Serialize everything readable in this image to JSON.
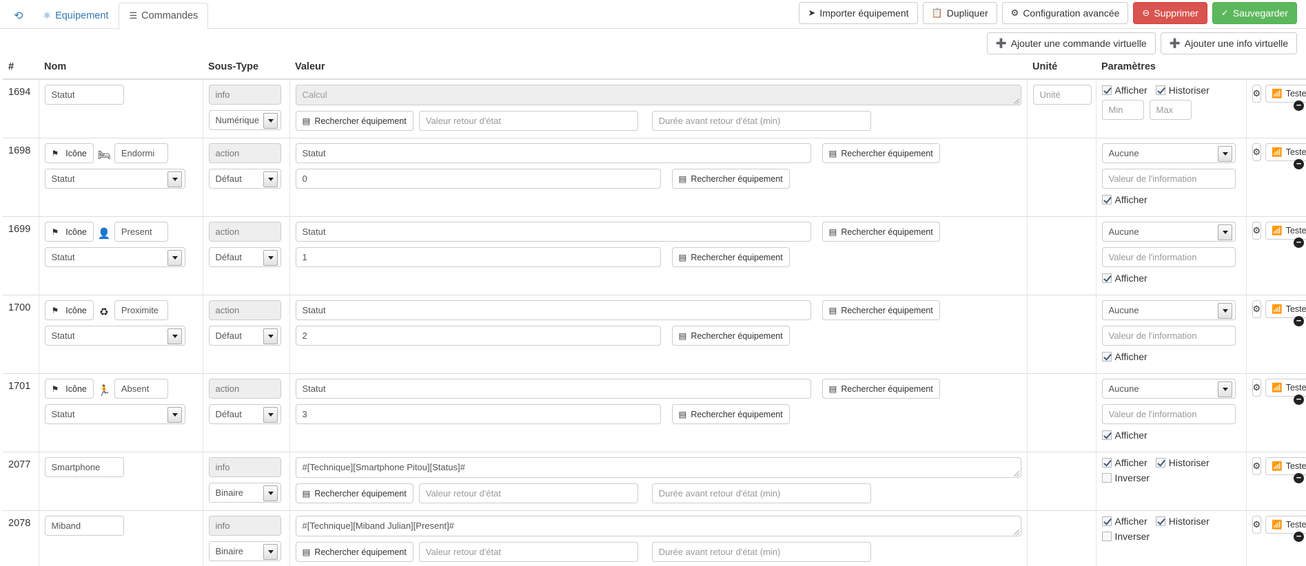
{
  "header": {
    "back_icon": "back-arrow-icon",
    "tabs": [
      {
        "label": "Equipement",
        "icon": "dashboard-icon",
        "active": false
      },
      {
        "label": "Commandes",
        "icon": "list-icon",
        "active": true
      }
    ],
    "toolbar": [
      {
        "label": "Importer équipement",
        "icon": "share-icon",
        "style": "default"
      },
      {
        "label": "Dupliquer",
        "icon": "copy-icon",
        "style": "default"
      },
      {
        "label": "Configuration avancée",
        "icon": "gears-icon",
        "style": "default"
      },
      {
        "label": "Supprimer",
        "icon": "minus-circle-icon",
        "style": "danger"
      },
      {
        "label": "Sauvegarder",
        "icon": "check-circle-icon",
        "style": "success"
      }
    ],
    "subtoolbar": [
      {
        "label": "Ajouter une commande virtuelle",
        "icon": "plus-circle-icon"
      },
      {
        "label": "Ajouter une info virtuelle",
        "icon": "plus-circle-icon"
      }
    ]
  },
  "colors": {
    "danger": "#d9534f",
    "success": "#5cb85c",
    "link": "#337ab7",
    "border": "#dddddd"
  },
  "table": {
    "columns": [
      "#",
      "Nom",
      "Sous-Type",
      "Valeur",
      "Unité",
      "Paramètres",
      ""
    ],
    "labels": {
      "rechercher": "Rechercher équipement",
      "tester": "Tester",
      "afficher": "Afficher",
      "historiser": "Historiser",
      "inverser": "Inverser",
      "gear": "gears-icon",
      "remove": "remove-icon"
    },
    "placeholders": {
      "calcul": "Calcul",
      "unite": "Unité",
      "valeur_retour": "Valeur retour d'état",
      "duree_retour": "Durée avant retour d'état (min)",
      "min": "Min",
      "max": "Max",
      "valeur_info": "Valeur de l'information"
    },
    "rows": [
      {
        "id": "1694",
        "kind": "info",
        "nom": {
          "value": "Statut"
        },
        "soustype": {
          "type": "info",
          "subtype": "Numérique"
        },
        "valeur": {
          "value": "",
          "placeholder": "Calcul"
        },
        "unite": {
          "value": "",
          "placeholder": "Unité"
        },
        "params": {
          "afficher": true,
          "historiser": true,
          "min": "",
          "max": ""
        }
      },
      {
        "id": "1698",
        "kind": "action",
        "nom": {
          "icon_button": "Icône",
          "glyph": "bed-icon",
          "value": "Endormi",
          "select": "Statut"
        },
        "soustype": {
          "type": "action",
          "subtype": "Défaut"
        },
        "valeur": {
          "line1": "Statut",
          "line2": "0"
        },
        "unite": {
          "value": ""
        },
        "params": {
          "select": "Aucune",
          "info_value": "",
          "afficher": true
        }
      },
      {
        "id": "1699",
        "kind": "action",
        "nom": {
          "icon_button": "Icône",
          "glyph": "user-icon",
          "value": "Present",
          "select": "Statut"
        },
        "soustype": {
          "type": "action",
          "subtype": "Défaut"
        },
        "valeur": {
          "line1": "Statut",
          "line2": "1"
        },
        "unite": {
          "value": ""
        },
        "params": {
          "select": "Aucune",
          "info_value": "",
          "afficher": true
        }
      },
      {
        "id": "1700",
        "kind": "action",
        "nom": {
          "icon_button": "Icône",
          "glyph": "recycle-icon",
          "value": "Proximite",
          "select": "Statut"
        },
        "soustype": {
          "type": "action",
          "subtype": "Défaut"
        },
        "valeur": {
          "line1": "Statut",
          "line2": "2"
        },
        "unite": {
          "value": ""
        },
        "params": {
          "select": "Aucune",
          "info_value": "",
          "afficher": true
        }
      },
      {
        "id": "1701",
        "kind": "action",
        "nom": {
          "icon_button": "Icône",
          "glyph": "running-icon",
          "value": "Absent",
          "select": "Statut"
        },
        "soustype": {
          "type": "action",
          "subtype": "Défaut"
        },
        "valeur": {
          "line1": "Statut",
          "line2": "3"
        },
        "unite": {
          "value": ""
        },
        "params": {
          "select": "Aucune",
          "info_value": "",
          "afficher": true
        }
      },
      {
        "id": "2077",
        "kind": "info-bin",
        "nom": {
          "value": "Smartphone"
        },
        "soustype": {
          "type": "info",
          "subtype": "Binaire"
        },
        "valeur": {
          "value": "#[Technique][Smartphone Pitou][Status]#"
        },
        "unite": {
          "value": ""
        },
        "params": {
          "afficher": true,
          "historiser": true,
          "inverser": false
        }
      },
      {
        "id": "2078",
        "kind": "info-bin",
        "nom": {
          "value": "Miband"
        },
        "soustype": {
          "type": "info",
          "subtype": "Binaire"
        },
        "valeur": {
          "value": "#[Technique][Miband Julian][Present]#"
        },
        "unite": {
          "value": ""
        },
        "params": {
          "afficher": true,
          "historiser": true,
          "inverser": false
        }
      }
    ]
  }
}
